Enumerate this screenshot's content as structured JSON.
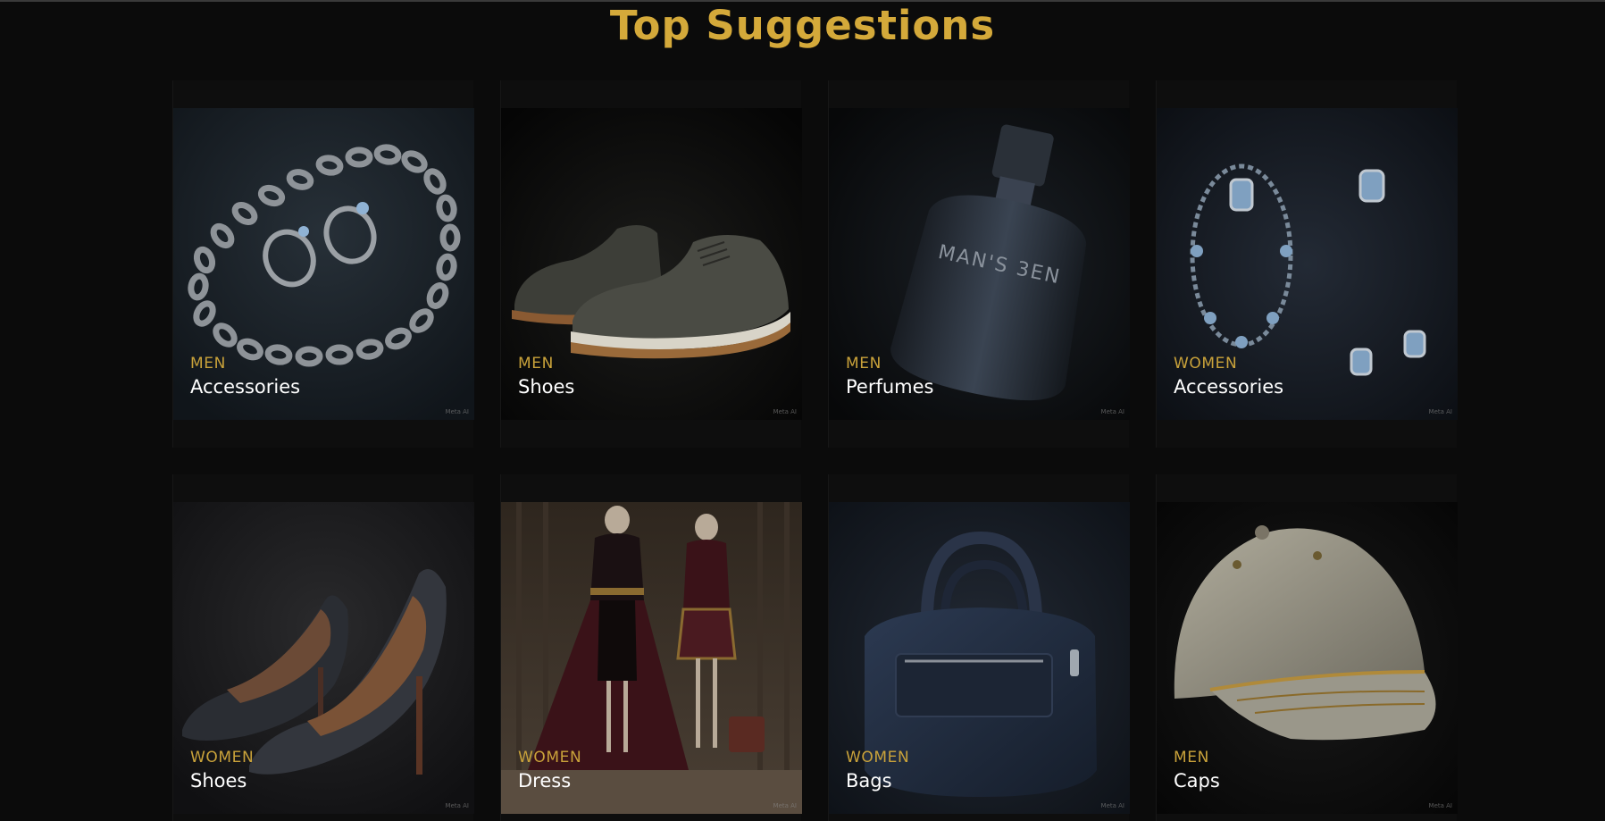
{
  "section": {
    "title": "Top Suggestions"
  },
  "cards": [
    {
      "category": "MEN",
      "name": "Accessories",
      "watermark": "Meta AI",
      "icon": "chain-bracelet-rings-icon"
    },
    {
      "category": "MEN",
      "name": "Shoes",
      "watermark": "Meta AI",
      "icon": "leather-shoes-icon"
    },
    {
      "category": "MEN",
      "name": "Perfumes",
      "watermark": "Meta AI",
      "icon": "perfume-bottle-icon",
      "label": "MAN'S 3EN"
    },
    {
      "category": "WOMEN",
      "name": "Accessories",
      "watermark": "Meta AI",
      "icon": "necklace-earrings-icon"
    },
    {
      "category": "WOMEN",
      "name": "Shoes",
      "watermark": "Meta AI",
      "icon": "high-heels-icon"
    },
    {
      "category": "WOMEN",
      "name": "Dress",
      "watermark": "Meta AI",
      "icon": "mannequin-dresses-icon"
    },
    {
      "category": "WOMEN",
      "name": "Bags",
      "watermark": "Meta AI",
      "icon": "handbag-icon"
    },
    {
      "category": "MEN",
      "name": "Caps",
      "watermark": "Meta AI",
      "icon": "baseball-cap-icon"
    }
  ],
  "colors": {
    "background": "#0b0b0b",
    "accent": "#d4a93a",
    "card_name": "#ffffff"
  }
}
